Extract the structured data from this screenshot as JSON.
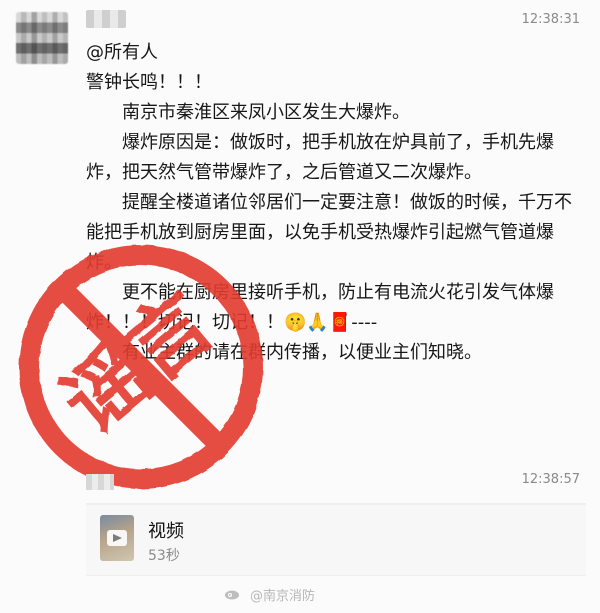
{
  "chat": {
    "messages": [
      {
        "time": "12:38:31",
        "mention": "@所有人",
        "lines": [
          "警钟长鸣！！！",
          "南京市秦淮区来凤小区发生大爆炸。",
          "爆炸原因是：做饭时，把手机放在炉具前了，手机先爆炸，把天然气管带爆炸了，之后管道又二次爆炸。",
          "提醒全楼道诸位邻居们一定要注意！做饭的时候，千万不能把手机放到厨房里面，以免手机受热爆炸引起燃气管道爆炸。",
          "更不能在厨房里接听手机，防止有电流火花引发气体爆炸！！！切记！切记！！🤫🙏🧧----",
          "有业主群的请在群内传播，以便业主们知晓。"
        ]
      },
      {
        "time": "12:38:57",
        "video": {
          "title": "视频",
          "duration": "53秒"
        }
      }
    ]
  },
  "stamp": {
    "text": "谣言",
    "color": "#e33a2f"
  },
  "watermark": {
    "text": "@南京消防"
  },
  "icons": {
    "avatar": "avatar",
    "play": "play-icon",
    "weibo": "weibo-icon"
  }
}
